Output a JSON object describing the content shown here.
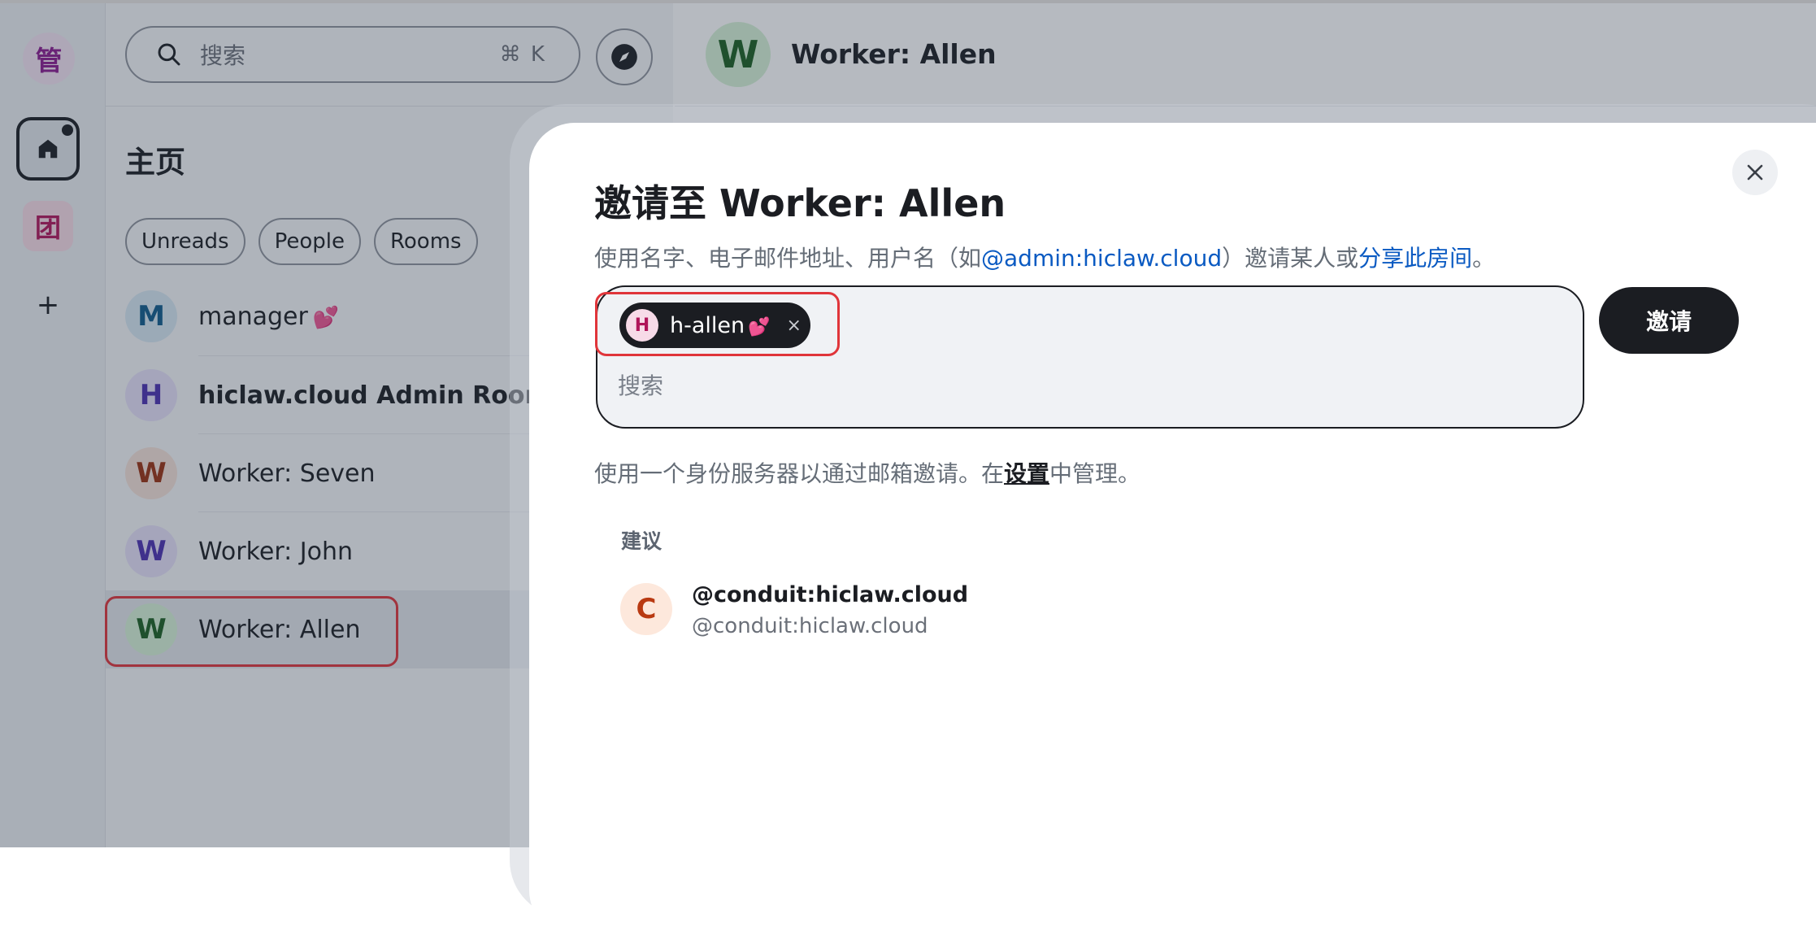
{
  "rail": {
    "user_initial": "管",
    "space_initial": "团",
    "add_label": "+"
  },
  "sidebar": {
    "search_placeholder": "搜索",
    "search_shortcut": "⌘ K",
    "home_title": "主页",
    "filters": [
      "Unreads",
      "People",
      "Rooms"
    ],
    "rooms": [
      {
        "initial": "M",
        "name": "manager",
        "heart": "💕",
        "bold": false,
        "avatar_bg": "#d7e7f2",
        "avatar_fg": "#0f5a8a"
      },
      {
        "initial": "H",
        "name": "hiclaw.cloud Admin Room",
        "heart": "",
        "bold": true,
        "avatar_bg": "#e5e0f7",
        "avatar_fg": "#4b2fb0"
      },
      {
        "initial": "W",
        "name": "Worker: Seven",
        "heart": "",
        "bold": false,
        "avatar_bg": "#f5e1d8",
        "avatar_fg": "#9a2f10"
      },
      {
        "initial": "W",
        "name": "Worker: John",
        "heart": "",
        "bold": false,
        "avatar_bg": "#e5e0f7",
        "avatar_fg": "#4b2fb0"
      },
      {
        "initial": "W",
        "name": "Worker: Allen",
        "heart": "",
        "bold": false,
        "avatar_bg": "#d6f2d6",
        "avatar_fg": "#1b5e20",
        "selected": true
      }
    ]
  },
  "main": {
    "room_initial": "W",
    "room_title": "Worker: Allen"
  },
  "dialog": {
    "title": "邀请至 Worker: Allen",
    "desc_prefix": "使用名字、电子邮件地址、用户名（如",
    "desc_example": "@admin:hiclaw.cloud",
    "desc_middle": "）邀请某人或",
    "desc_share_link": "分享此房间",
    "desc_suffix": "。",
    "pill": {
      "initial": "H",
      "name": "h-allen",
      "heart": "💕",
      "remove": "×"
    },
    "field_placeholder": "搜索",
    "invite_button": "邀请",
    "identity_prefix": "使用一个身份服务器以通过邮箱邀请。在",
    "identity_link": "设置",
    "identity_suffix": "中管理。",
    "suggestions_heading": "建议",
    "suggestions": [
      {
        "initial": "C",
        "display_name": "@conduit:hiclaw.cloud",
        "user_id": "@conduit:hiclaw.cloud"
      }
    ]
  },
  "colors": {
    "highlight_box": "#e0353a",
    "link": "#0a5ac2",
    "primary_button": "#1b1d22"
  }
}
